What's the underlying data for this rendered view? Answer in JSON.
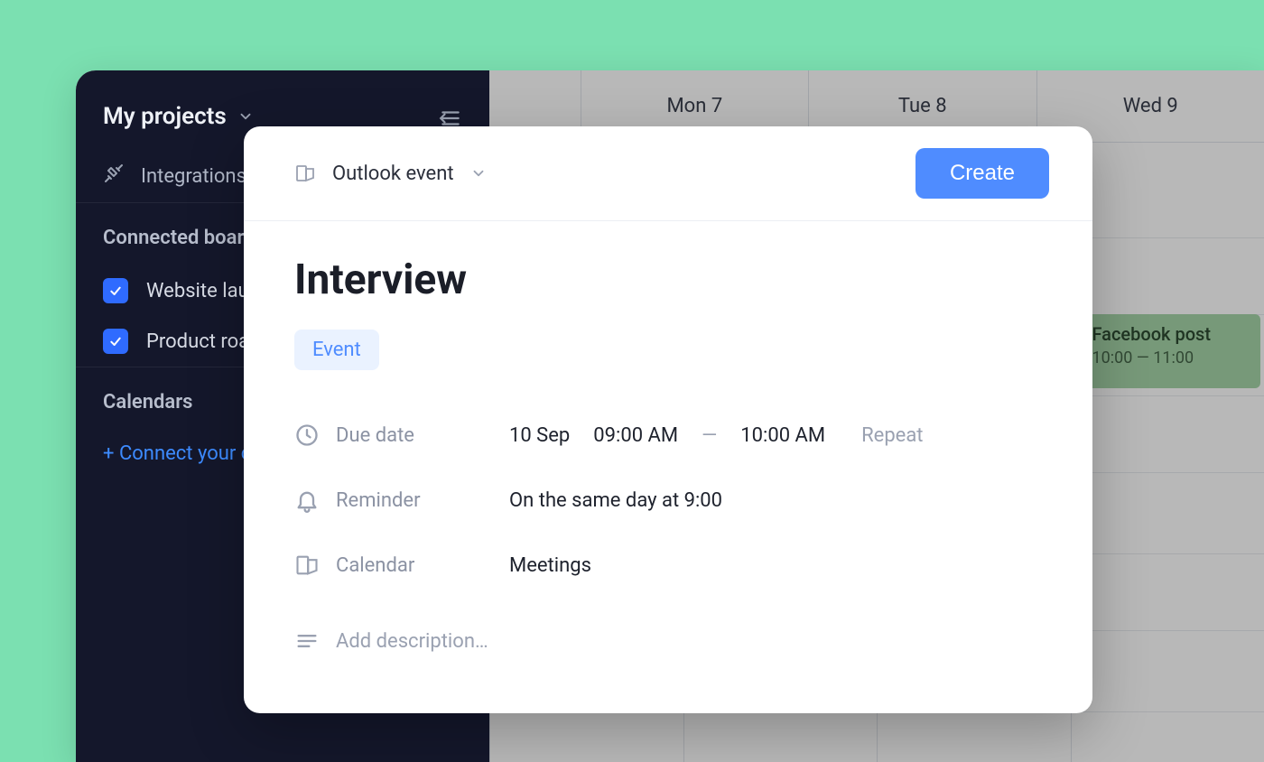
{
  "sidebar": {
    "title": "My projects",
    "integration_label": "Integrations",
    "connected_section": "Connected boards",
    "boards": [
      {
        "label": "Website launch",
        "checked": true
      },
      {
        "label": "Product roadmap",
        "checked": true
      }
    ],
    "calendars_section": "Calendars",
    "connect_link": "+ Connect your calendar"
  },
  "calendar": {
    "day_headers": [
      "",
      "Mon 7",
      "Tue 8",
      "Wed 9"
    ],
    "bg_event": {
      "title": "Facebook post",
      "time": "10:00 — 11:00"
    }
  },
  "modal": {
    "type_label": "Outlook event",
    "create_label": "Create",
    "title": "Interview",
    "badge": "Event",
    "due_label": "Due date",
    "due_date": "10 Sep",
    "due_start": "09:00 AM",
    "due_dash": "—",
    "due_end": "10:00 AM",
    "repeat_label": "Repeat",
    "reminder_label": "Reminder",
    "reminder_value": "On the same day at 9:00",
    "calendar_label": "Calendar",
    "calendar_value": "Meetings",
    "description_placeholder": "Add description…"
  }
}
